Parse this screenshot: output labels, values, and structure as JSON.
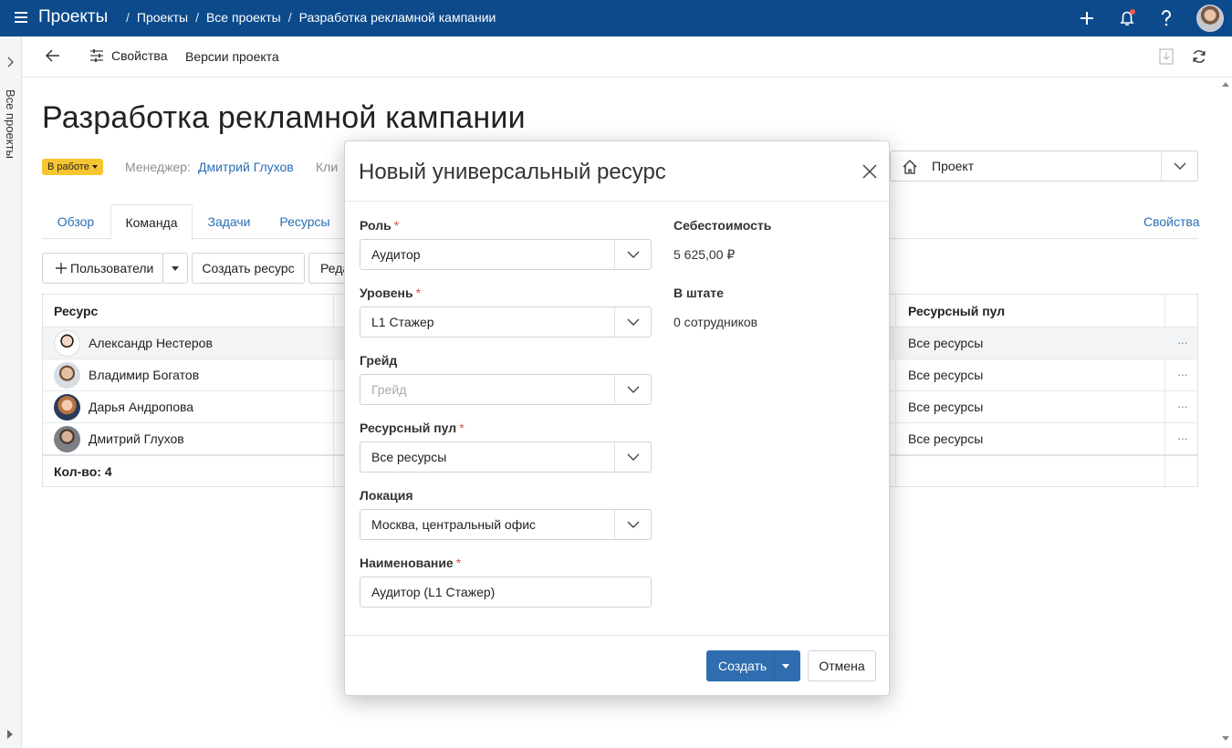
{
  "topbar": {
    "app_title": "Проекты",
    "breadcrumbs": [
      "Проекты",
      "Все проекты",
      "Разработка рекламной кампании"
    ],
    "separator": "/",
    "accent": "#0c4a8c"
  },
  "leftrail": {
    "label": "Все проекты"
  },
  "toolbar": {
    "properties_label": "Свойства",
    "versions_label": "Версии проекта"
  },
  "page": {
    "title": "Разработка рекламной кампании",
    "status": "В работе",
    "manager_label": "Менеджер:",
    "manager_value": "Дмитрий Глухов",
    "client_label": "Кли",
    "project_select": "Проект"
  },
  "tabs": [
    "Обзор",
    "Команда",
    "Задачи",
    "Ресурсы"
  ],
  "active_tab": "Команда",
  "properties_link": "Свойства",
  "actions": {
    "users": "Пользователи",
    "create_resource": "Создать ресурс",
    "edit": "Реда"
  },
  "table": {
    "columns": {
      "resource": "Ресурс",
      "pool": "Ресурсный пул"
    },
    "rows": [
      {
        "name": "Александр Нестеров",
        "pool": "Все ресурсы"
      },
      {
        "name": "Владимир Богатов",
        "pool": "Все ресурсы"
      },
      {
        "name": "Дарья Андропова",
        "pool": "Все ресурсы"
      },
      {
        "name": "Дмитрий Глухов",
        "pool": "Все ресурсы"
      }
    ],
    "more": "···",
    "footer": "Кол-во: 4"
  },
  "modal": {
    "title": "Новый универсальный ресурс",
    "fields": {
      "role": {
        "label": "Роль",
        "value": "Аудитор",
        "required": true
      },
      "level": {
        "label": "Уровень",
        "value": "L1 Стажер",
        "required": true
      },
      "grade": {
        "label": "Грейд",
        "placeholder": "Грейд",
        "required": false
      },
      "pool": {
        "label": "Ресурсный пул",
        "value": "Все ресурсы",
        "required": true
      },
      "location": {
        "label": "Локация",
        "value": "Москва, центральный офис",
        "required": false
      },
      "name": {
        "label": "Наименование",
        "value": "Аудитор (L1 Стажер)",
        "required": true
      }
    },
    "cost_label": "Себестоимость",
    "cost_value": "5 625,00 ₽",
    "staff_label": "В штате",
    "staff_value": "0 сотрудников",
    "required_mark": "*",
    "create_button": "Создать",
    "cancel_button": "Отмена",
    "primary_color": "#2f6db0"
  }
}
